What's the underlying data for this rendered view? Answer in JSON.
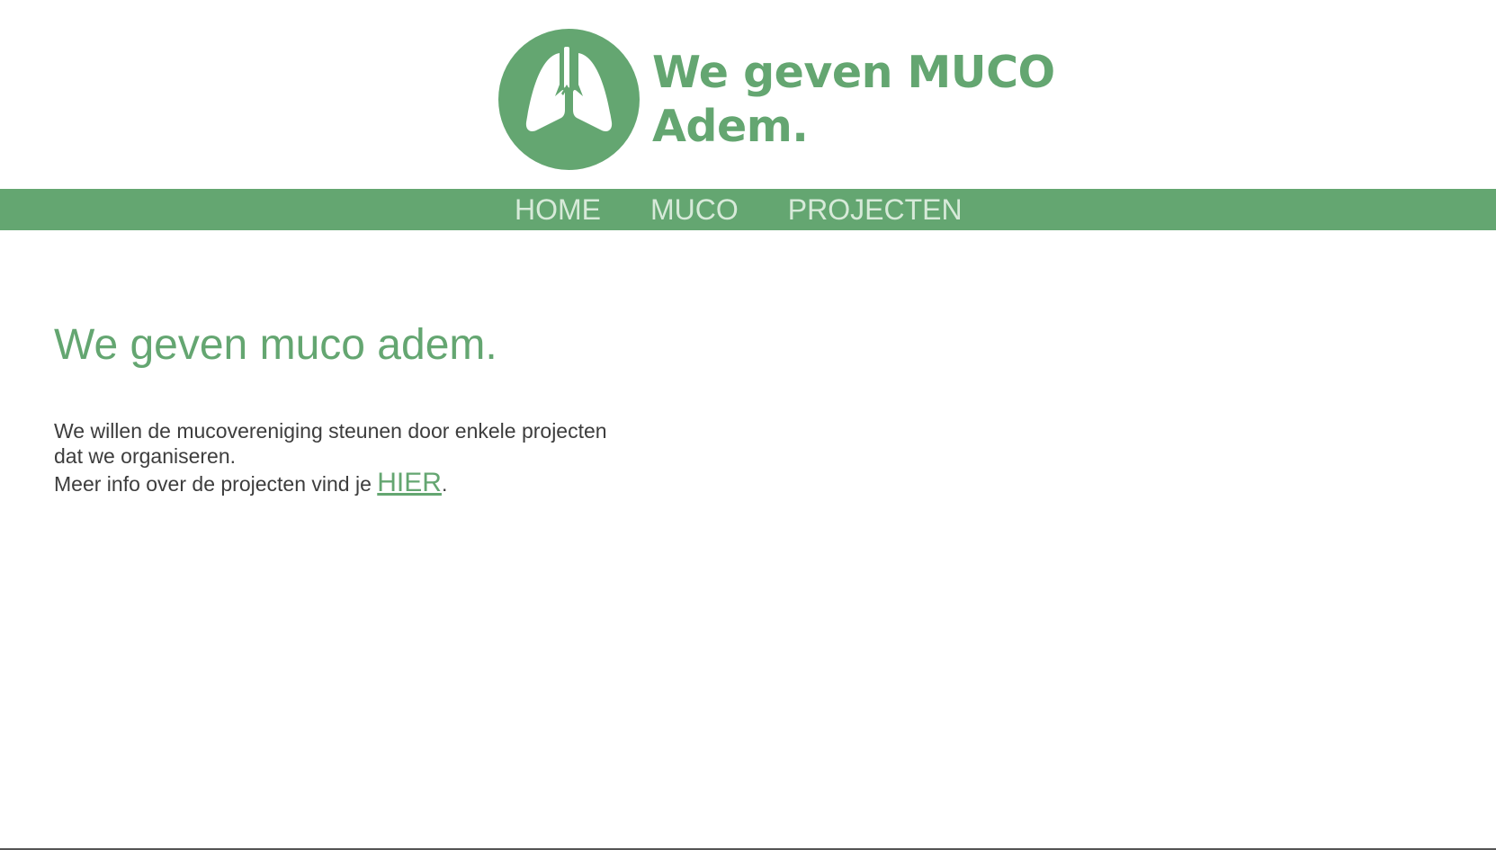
{
  "brand": {
    "line1": "We geven MUCO",
    "line2": "Adem.",
    "color": "#64a671",
    "logo_icon": "lungs-icon"
  },
  "nav": {
    "items": [
      {
        "label": "HOME"
      },
      {
        "label": "MUCO"
      },
      {
        "label": "PROJECTEN"
      }
    ],
    "background": "#64a671",
    "text_color": "#d7ead9"
  },
  "main": {
    "title": "We geven muco adem.",
    "intro": "We willen de mucovereniging steunen door enkele projecten dat we organiseren.",
    "more_prefix": "Meer info over de projecten vind je ",
    "more_link": "HIER",
    "more_suffix": "."
  }
}
